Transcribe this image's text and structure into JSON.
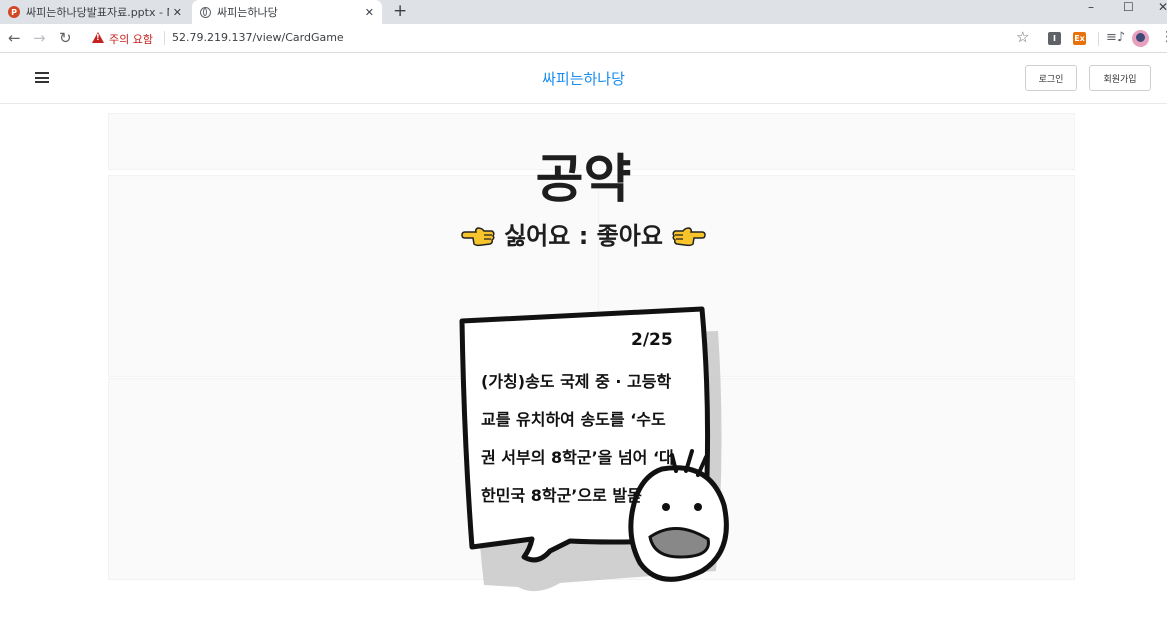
{
  "browser": {
    "tabs": [
      {
        "title": "싸피는하나당발표자료.pptx - Mi",
        "icon": "powerpoint-icon",
        "active": false
      },
      {
        "title": "싸피는하나당",
        "icon": "globe-icon",
        "active": true
      }
    ],
    "security_warning": "주의 요함",
    "url": "52.79.219.137/view/CardGame",
    "extension_1_label": "I",
    "extension_2_label": "Ex"
  },
  "header": {
    "brand": "싸피는하나당",
    "login_label": "로그인",
    "signup_label": "회원가입",
    "brand_color": "#1a8ef0"
  },
  "main": {
    "title": "공약",
    "dislike_label": "싫어요",
    "separator": ":",
    "like_label": "좋아요"
  },
  "card": {
    "counter": "2/25",
    "lines": [
      "(가칭)송도 국제 중 · 고등학",
      "교를 유치하여 송도를 ‘수도",
      "권 서부의 8학군’을 넘어 ‘대",
      "한민국 8학군’으로 발돋"
    ]
  }
}
